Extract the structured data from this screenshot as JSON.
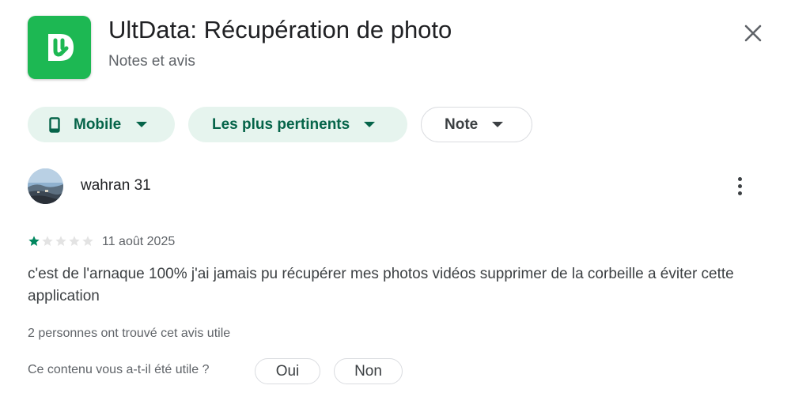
{
  "header": {
    "app_icon": "ultdata-logo-icon",
    "title": "UltData: Récupération de photo",
    "subtitle": "Notes et avis",
    "close_icon": "close-icon"
  },
  "filters": {
    "device": {
      "label": "Mobile",
      "icon": "phone-icon",
      "dropdown_icon": "caret-down-icon"
    },
    "sort": {
      "label": "Les plus pertinents",
      "dropdown_icon": "caret-down-icon"
    },
    "rating": {
      "label": "Note",
      "dropdown_icon": "caret-down-icon"
    }
  },
  "review": {
    "author": "wahran 31",
    "more_icon": "more-vert-icon",
    "rating": 1,
    "max_rating": 5,
    "date": "11 août 2025",
    "text": "c'est de l'arnaque 100% j'ai jamais pu récupérer mes photos vidéos supprimer de la corbeille a éviter cette application",
    "helpful_count_text": "2 personnes ont trouvé cet avis utile",
    "feedback": {
      "question": "Ce contenu vous a-t-il été utile ?",
      "yes_label": "Oui",
      "no_label": "Non"
    }
  },
  "colors": {
    "app_icon_bg": "#1db853",
    "chip_filled_bg": "#e6f4ee",
    "chip_filled_text": "#056449",
    "star_filled": "#01875f",
    "star_empty": "#e3e3e3"
  }
}
